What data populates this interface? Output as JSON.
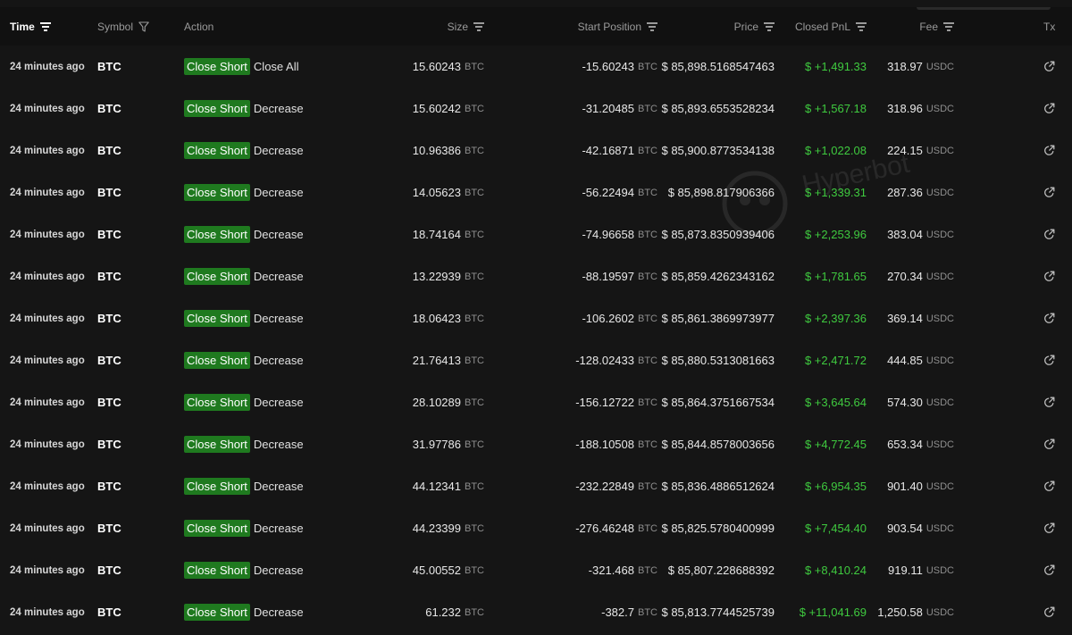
{
  "header": {
    "time": "Time",
    "symbol": "Symbol",
    "action": "Action",
    "size": "Size",
    "start_position": "Start Position",
    "price": "Price",
    "closed_pnl": "Closed PnL",
    "fee": "Fee",
    "tx": "Tx"
  },
  "watermark": "Hyperbot",
  "colors": {
    "badge": "#1f7a1f",
    "pnl_positive": "#3fca3f",
    "background": "#151515"
  },
  "rows": [
    {
      "time": "24 minutes ago",
      "symbol": "BTC",
      "badge": "Close Short",
      "action": "Close All",
      "size": "15.60243",
      "size_unit": "BTC",
      "start_position": "-15.60243",
      "start_unit": "BTC",
      "price": "$ 85,898.5168547463",
      "pnl": "$ +1,491.33",
      "fee": "318.97",
      "fee_unit": "USDC"
    },
    {
      "time": "24 minutes ago",
      "symbol": "BTC",
      "badge": "Close Short",
      "action": "Decrease",
      "size": "15.60242",
      "size_unit": "BTC",
      "start_position": "-31.20485",
      "start_unit": "BTC",
      "price": "$ 85,893.6553528234",
      "pnl": "$ +1,567.18",
      "fee": "318.96",
      "fee_unit": "USDC"
    },
    {
      "time": "24 minutes ago",
      "symbol": "BTC",
      "badge": "Close Short",
      "action": "Decrease",
      "size": "10.96386",
      "size_unit": "BTC",
      "start_position": "-42.16871",
      "start_unit": "BTC",
      "price": "$ 85,900.8773534138",
      "pnl": "$ +1,022.08",
      "fee": "224.15",
      "fee_unit": "USDC"
    },
    {
      "time": "24 minutes ago",
      "symbol": "BTC",
      "badge": "Close Short",
      "action": "Decrease",
      "size": "14.05623",
      "size_unit": "BTC",
      "start_position": "-56.22494",
      "start_unit": "BTC",
      "price": "$ 85,898.817906366",
      "pnl": "$ +1,339.31",
      "fee": "287.36",
      "fee_unit": "USDC"
    },
    {
      "time": "24 minutes ago",
      "symbol": "BTC",
      "badge": "Close Short",
      "action": "Decrease",
      "size": "18.74164",
      "size_unit": "BTC",
      "start_position": "-74.96658",
      "start_unit": "BTC",
      "price": "$ 85,873.8350939406",
      "pnl": "$ +2,253.96",
      "fee": "383.04",
      "fee_unit": "USDC"
    },
    {
      "time": "24 minutes ago",
      "symbol": "BTC",
      "badge": "Close Short",
      "action": "Decrease",
      "size": "13.22939",
      "size_unit": "BTC",
      "start_position": "-88.19597",
      "start_unit": "BTC",
      "price": "$ 85,859.4262343162",
      "pnl": "$ +1,781.65",
      "fee": "270.34",
      "fee_unit": "USDC"
    },
    {
      "time": "24 minutes ago",
      "symbol": "BTC",
      "badge": "Close Short",
      "action": "Decrease",
      "size": "18.06423",
      "size_unit": "BTC",
      "start_position": "-106.2602",
      "start_unit": "BTC",
      "price": "$ 85,861.3869973977",
      "pnl": "$ +2,397.36",
      "fee": "369.14",
      "fee_unit": "USDC"
    },
    {
      "time": "24 minutes ago",
      "symbol": "BTC",
      "badge": "Close Short",
      "action": "Decrease",
      "size": "21.76413",
      "size_unit": "BTC",
      "start_position": "-128.02433",
      "start_unit": "BTC",
      "price": "$ 85,880.5313081663",
      "pnl": "$ +2,471.72",
      "fee": "444.85",
      "fee_unit": "USDC"
    },
    {
      "time": "24 minutes ago",
      "symbol": "BTC",
      "badge": "Close Short",
      "action": "Decrease",
      "size": "28.10289",
      "size_unit": "BTC",
      "start_position": "-156.12722",
      "start_unit": "BTC",
      "price": "$ 85,864.3751667534",
      "pnl": "$ +3,645.64",
      "fee": "574.30",
      "fee_unit": "USDC"
    },
    {
      "time": "24 minutes ago",
      "symbol": "BTC",
      "badge": "Close Short",
      "action": "Decrease",
      "size": "31.97786",
      "size_unit": "BTC",
      "start_position": "-188.10508",
      "start_unit": "BTC",
      "price": "$ 85,844.8578003656",
      "pnl": "$ +4,772.45",
      "fee": "653.34",
      "fee_unit": "USDC"
    },
    {
      "time": "24 minutes ago",
      "symbol": "BTC",
      "badge": "Close Short",
      "action": "Decrease",
      "size": "44.12341",
      "size_unit": "BTC",
      "start_position": "-232.22849",
      "start_unit": "BTC",
      "price": "$ 85,836.4886512624",
      "pnl": "$ +6,954.35",
      "fee": "901.40",
      "fee_unit": "USDC"
    },
    {
      "time": "24 minutes ago",
      "symbol": "BTC",
      "badge": "Close Short",
      "action": "Decrease",
      "size": "44.23399",
      "size_unit": "BTC",
      "start_position": "-276.46248",
      "start_unit": "BTC",
      "price": "$ 85,825.5780400999",
      "pnl": "$ +7,454.40",
      "fee": "903.54",
      "fee_unit": "USDC"
    },
    {
      "time": "24 minutes ago",
      "symbol": "BTC",
      "badge": "Close Short",
      "action": "Decrease",
      "size": "45.00552",
      "size_unit": "BTC",
      "start_position": "-321.468",
      "start_unit": "BTC",
      "price": "$ 85,807.228688392",
      "pnl": "$ +8,410.24",
      "fee": "919.11",
      "fee_unit": "USDC"
    },
    {
      "time": "24 minutes ago",
      "symbol": "BTC",
      "badge": "Close Short",
      "action": "Decrease",
      "size": "61.232",
      "size_unit": "BTC",
      "start_position": "-382.7",
      "start_unit": "BTC",
      "price": "$ 85,813.7744525739",
      "pnl": "$ +11,041.69",
      "fee": "1,250.58",
      "fee_unit": "USDC"
    }
  ]
}
